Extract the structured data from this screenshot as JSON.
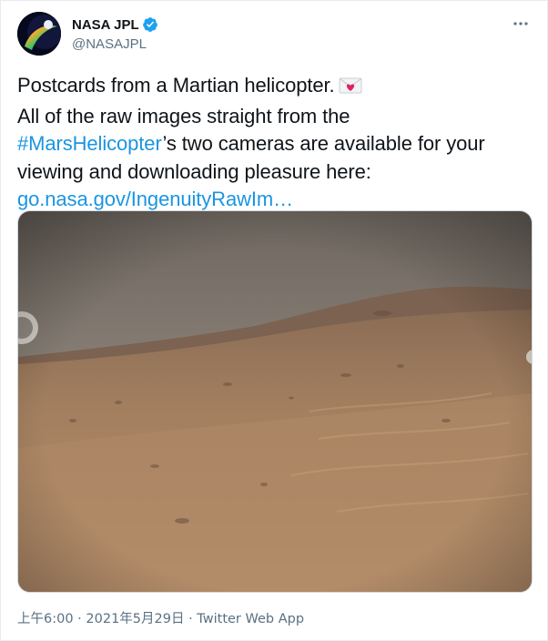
{
  "account": {
    "display_name": "NASA JPL",
    "handle": "@NASAJPL",
    "verified_icon": "verified-badge-icon",
    "avatar_icon": "nasa-jpl-logo-icon"
  },
  "tweet": {
    "line1": "Postcards from a Martian helicopter.",
    "line1_emoji": "love-letter-envelope-icon",
    "line2": "All of the raw images straight from the",
    "hashtag": "#MarsHelicopter",
    "line3_rest": "’s two cameras are available for your",
    "line4": "viewing and downloading pleasure here:",
    "link": "go.nasa.gov/IngenuityRawIm…",
    "media_icon": "mars-landscape-photo"
  },
  "meta": {
    "time": "上午6:00",
    "separator": " · ",
    "date": "2021年5月29日",
    "source": "Twitter Web App"
  },
  "colors": {
    "link": "#1b95e0",
    "secondary_text": "#5b7083",
    "primary_text": "#0f1419",
    "verified": "#1da1f2"
  }
}
